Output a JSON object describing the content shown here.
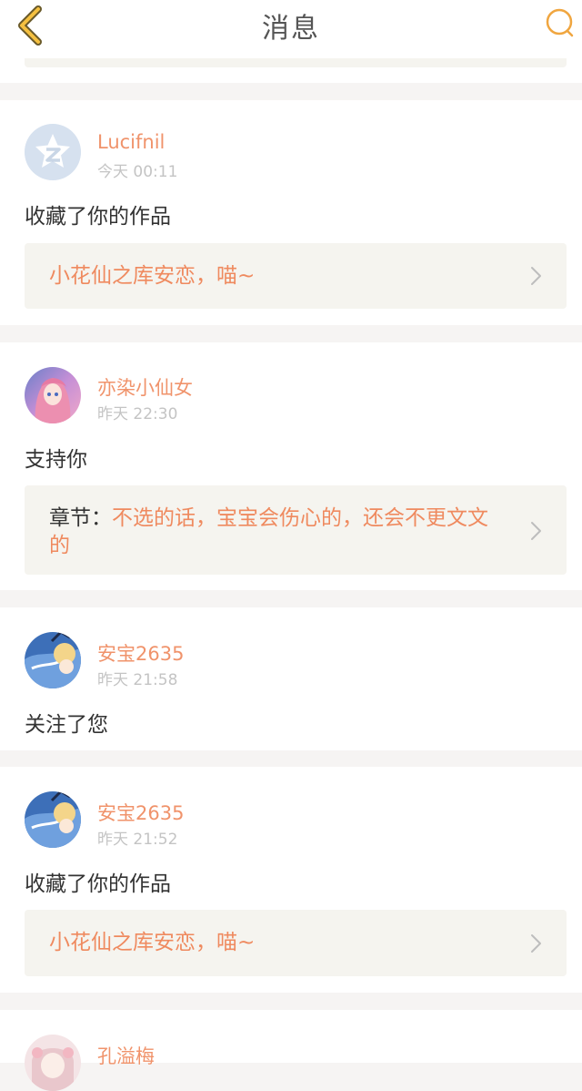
{
  "header": {
    "title": "消息"
  },
  "messages": [
    {
      "user": "Lucifnil",
      "time": "今天 00:11",
      "action": "收藏了你的作品",
      "ref_title": "小花仙之库安恋，喵~"
    },
    {
      "user": "亦染小仙女",
      "time": "昨天 22:30",
      "action": "支持你",
      "ref_prefix": "章节：",
      "ref_title": "不选的话，宝宝会伤心的，还会不更文文的"
    },
    {
      "user": "安宝2635",
      "time": "昨天 21:58",
      "action": "关注了您"
    },
    {
      "user": "安宝2635",
      "time": "昨天 21:52",
      "action": "收藏了你的作品",
      "ref_title": "小花仙之库安恋，喵~"
    },
    {
      "user": "孔溢梅"
    }
  ],
  "colors": {
    "accent": "#f0936b",
    "icon": "#f0a640",
    "background": "#f6f4f3"
  }
}
